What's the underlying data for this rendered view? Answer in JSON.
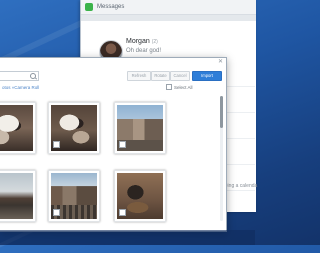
{
  "messages_window": {
    "title": "Messages",
    "conversation": {
      "name": "Morgan",
      "count": "(2)",
      "preview": "Oh dear god!"
    },
    "calendar_hint": "being a calenda"
  },
  "photo_picker": {
    "close_label": "✕",
    "search": {
      "placeholder": ""
    },
    "buttons": {
      "refresh": "Refresh",
      "rotate": "Rotate",
      "cancel": "Cancel",
      "import": "Import"
    },
    "breadcrumb": "otos »Camera Roll",
    "select_all_label": "Select All",
    "photos": [
      {
        "name": "cat-photo-1",
        "image": "cat"
      },
      {
        "name": "cat-photo-2",
        "image": "cat"
      },
      {
        "name": "building-photo",
        "image": "building"
      },
      {
        "name": "bridge-photo",
        "image": "bridge"
      },
      {
        "name": "street-photo",
        "image": "street"
      },
      {
        "name": "dog-photo",
        "image": "dog"
      }
    ],
    "colors": {
      "accent": "#2f7ed8",
      "link": "#4a83c8"
    }
  }
}
